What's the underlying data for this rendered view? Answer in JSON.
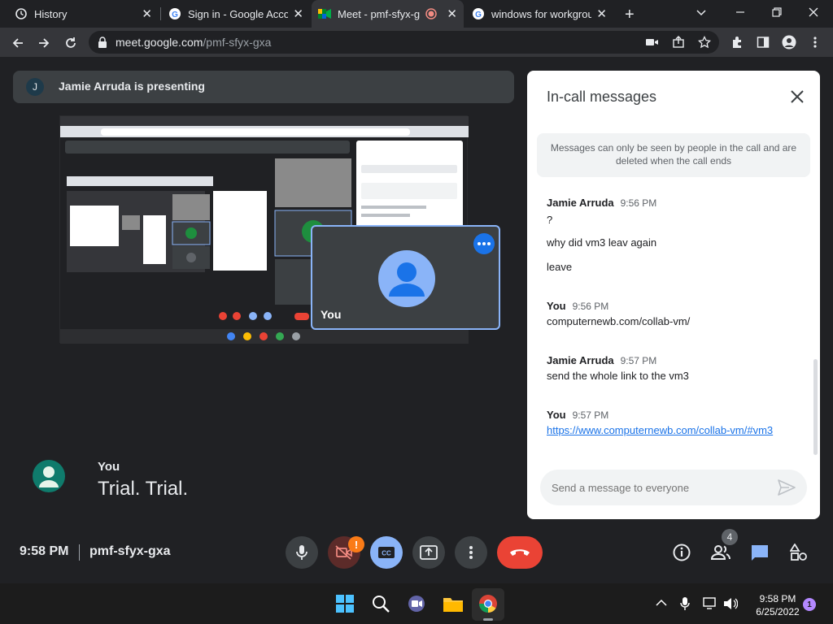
{
  "browser": {
    "tabs": [
      {
        "title": "History",
        "icon": "history-icon"
      },
      {
        "title": "Sign in - Google Accou",
        "icon": "google-icon"
      },
      {
        "title": "Meet - pmf-sfyx-g",
        "icon": "meet-icon",
        "active": true
      },
      {
        "title": "windows for workgroup",
        "icon": "google-icon"
      }
    ],
    "url_host": "meet.google.com",
    "url_path": "/pmf-sfyx-gxa"
  },
  "meet": {
    "presenter_initial": "J",
    "presenting_text": "Jamie Arruda is presenting",
    "self_tile_label": "You",
    "caption": {
      "speaker": "You",
      "text": "Trial. Trial."
    },
    "bottom": {
      "time": "9:58 PM",
      "code": "pmf-sfyx-gxa",
      "participants_badge": "4",
      "camera_alert": "!"
    }
  },
  "chat": {
    "title": "In-call messages",
    "notice": "Messages can only be seen by people in the call and are deleted when the call ends",
    "messages": [
      {
        "sender": "Jamie Arruda",
        "time": "9:56 PM",
        "lines": [
          "?",
          "why did vm3 leav again",
          "leave"
        ]
      },
      {
        "sender": "You",
        "time": "9:56 PM",
        "lines": [
          "computernewb.com/collab-vm/"
        ]
      },
      {
        "sender": "Jamie Arruda",
        "time": "9:57 PM",
        "lines": [
          "send the whole link to the vm3"
        ]
      },
      {
        "sender": "You",
        "time": "9:57 PM",
        "link": "https://www.computernewb.com/collab-vm/#vm3"
      }
    ],
    "input_placeholder": "Send a message to everyone"
  },
  "taskbar": {
    "time": "9:58 PM",
    "date": "6/25/2022",
    "notification_count": "1"
  },
  "colors": {
    "accent": "#8ab4f8",
    "end_call": "#ea4335",
    "cc_active": "#8ab4f8",
    "camera_off": "#5c2b29",
    "background": "#202124"
  }
}
